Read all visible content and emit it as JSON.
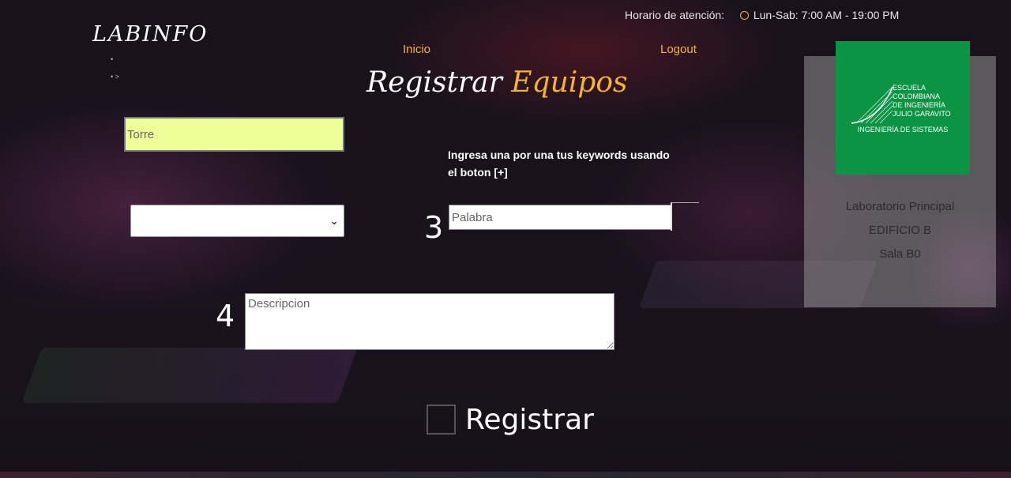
{
  "brand": {
    "logo_text": "LABINFO"
  },
  "header": {
    "hours_label": "Horario de atención:",
    "hours_value": "Lun-Sab: 7:00 AM - 19:00 PM",
    "nav": {
      "inicio": "Inicio",
      "logout": "Logout"
    },
    "title_main": "Registrar",
    "title_accent": "Equipos"
  },
  "form": {
    "torre_placeholder": "Torre",
    "select_value": "",
    "keywords_hint": "Ingresa una por una tus keywords usando el boton [+]",
    "step3": "3",
    "palabra_placeholder": "Palabra",
    "step4": "4",
    "descripcion_placeholder": "Descripcion",
    "submit_label": "Registrar"
  },
  "sidebar": {
    "logo_lines": [
      "Escuela",
      "Colombiana",
      "de Ingeniería",
      "Julio Garavito"
    ],
    "logo_dept": "INGENIERÍA DE SISTEMAS",
    "lab_name": "Laboratorio Principal",
    "building": "EDIFICIO B",
    "room": "Sala B0"
  },
  "colors": {
    "accent": "#f5b52b",
    "torre_bg": "#eeff99",
    "logo_green": "#0b9444",
    "panel": "#969196"
  },
  "icons": [
    "clock-icon",
    "chevron-down-icon"
  ]
}
